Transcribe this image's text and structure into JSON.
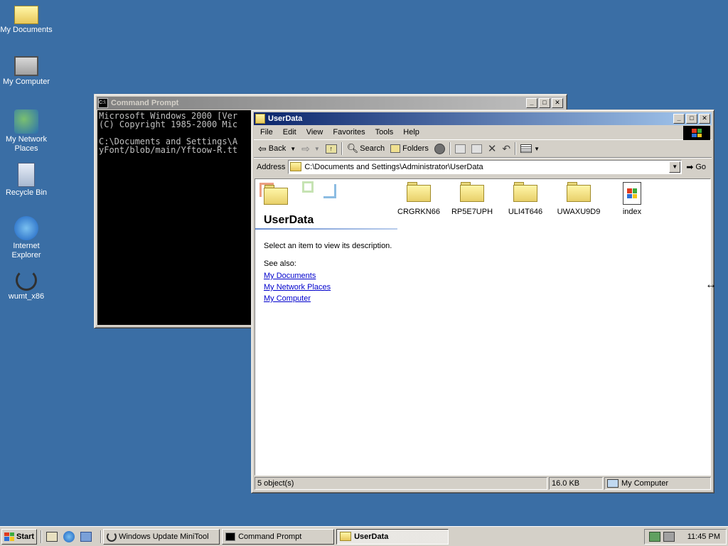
{
  "desktop": {
    "icons": [
      {
        "label_lines": [
          "My Documents"
        ],
        "icon": "folder-documents-icon"
      },
      {
        "label_lines": [
          "My Computer"
        ],
        "icon": "computer-icon"
      },
      {
        "label_lines": [
          "My Network",
          "Places"
        ],
        "icon": "network-icon"
      },
      {
        "label_lines": [
          "Recycle Bin"
        ],
        "icon": "recycle-bin-icon"
      },
      {
        "label_lines": [
          "Internet",
          "Explorer"
        ],
        "icon": "internet-explorer-icon"
      },
      {
        "label_lines": [
          "wumt_x86"
        ],
        "icon": "refresh-arrow-icon"
      }
    ]
  },
  "cmd": {
    "title": "Command Prompt",
    "lines": [
      "Microsoft Windows 2000 [Ver",
      "(C) Copyright 1985-2000 Mic",
      "",
      "C:\\Documents and Settings\\A",
      "yFont/blob/main/Yftoow-R.tt"
    ]
  },
  "explorer": {
    "title": "UserData",
    "menu": [
      "File",
      "Edit",
      "View",
      "Favorites",
      "Tools",
      "Help"
    ],
    "toolbar": {
      "back": "Back",
      "search": "Search",
      "folders": "Folders"
    },
    "address_label": "Address",
    "address_value": "C:\\Documents and Settings\\Administrator\\UserData",
    "go_label": "Go",
    "panel": {
      "heading": "UserData",
      "description": "Select an item to view its description.",
      "see_also": "See also:",
      "links": [
        "My Documents",
        "My Network Places",
        "My Computer"
      ]
    },
    "items": [
      {
        "name": "CRGRKN66",
        "type": "folder"
      },
      {
        "name": "RP5E7UPH",
        "type": "folder"
      },
      {
        "name": "ULI4T646",
        "type": "folder"
      },
      {
        "name": "UWAXU9D9",
        "type": "folder"
      },
      {
        "name": "index",
        "type": "html-file"
      }
    ],
    "status": {
      "count": "5 object(s)",
      "size": "16.0 KB",
      "zone": "My Computer"
    }
  },
  "taskbar": {
    "start": "Start",
    "tasks": [
      {
        "label": "Windows Update MiniTool",
        "active": false
      },
      {
        "label": "Command Prompt",
        "active": false
      },
      {
        "label": "UserData",
        "active": true
      }
    ],
    "clock": "11:45 PM"
  },
  "colors": {
    "desktop": "#3a6ea5",
    "title_active": "#0a246a",
    "title_inactive": "#808080",
    "face": "#d4d0c8"
  }
}
